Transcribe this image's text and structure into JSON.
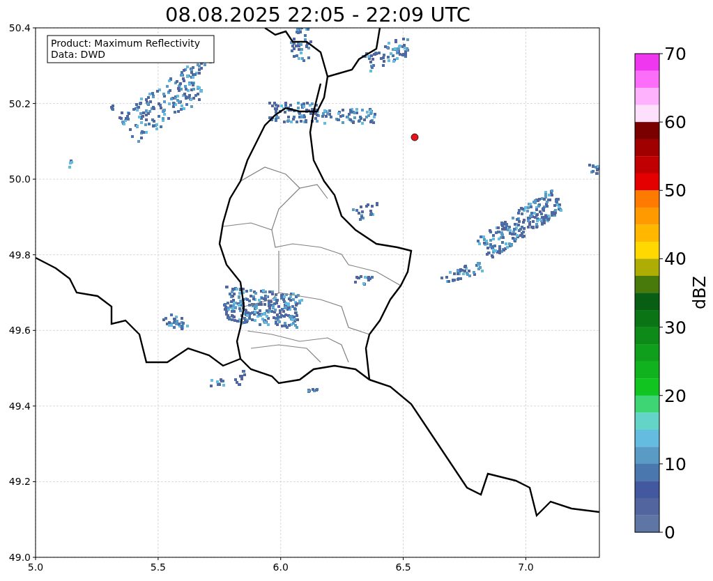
{
  "title": "08.08.2025 22:05 - 22:09 UTC",
  "legend": [
    "Product: Maximum Reflectivity",
    "Data: DWD"
  ],
  "x_ticks": [
    "5.0",
    "5.5",
    "6.0",
    "6.5",
    "7.0"
  ],
  "y_ticks": [
    "50.4",
    "50.2",
    "50.0",
    "49.8",
    "49.6",
    "49.4",
    "49.2",
    "49.0"
  ],
  "colorbar": {
    "label": "dBZ",
    "ticks": [
      "70",
      "60",
      "50",
      "40",
      "30",
      "20",
      "10",
      "0"
    ],
    "segments": [
      {
        "color": "#ee37ee"
      },
      {
        "color": "#fc6dfa"
      },
      {
        "color": "#feb2fd"
      },
      {
        "color": "#fee0fd"
      },
      {
        "color": "#7a0000"
      },
      {
        "color": "#a00000"
      },
      {
        "color": "#c00000"
      },
      {
        "color": "#e40000"
      },
      {
        "color": "#ff7a00"
      },
      {
        "color": "#ff9a00"
      },
      {
        "color": "#ffb700"
      },
      {
        "color": "#fed800"
      },
      {
        "color": "#adad06"
      },
      {
        "color": "#487a0b"
      },
      {
        "color": "#085e12"
      },
      {
        "color": "#0b7515"
      },
      {
        "color": "#0e8a18"
      },
      {
        "color": "#0f9f1d"
      },
      {
        "color": "#10b21e"
      },
      {
        "color": "#11c41f"
      },
      {
        "color": "#3ed675"
      },
      {
        "color": "#62d5c8"
      },
      {
        "color": "#64bde0"
      },
      {
        "color": "#5a9bc6"
      },
      {
        "color": "#4a77ae"
      },
      {
        "color": "#42599f"
      },
      {
        "color": "#53659f"
      },
      {
        "color": "#5f75a6"
      }
    ]
  }
}
